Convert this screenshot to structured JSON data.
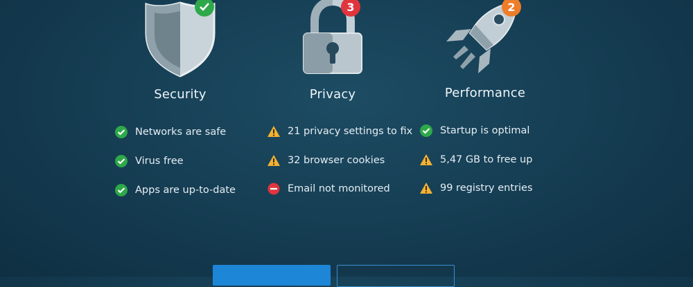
{
  "security": {
    "title": "Security",
    "icon": "shield-icon",
    "badge_icon": "checkmark-icon",
    "items": [
      {
        "status": "ok",
        "label": "Networks are safe"
      },
      {
        "status": "ok",
        "label": "Virus free"
      },
      {
        "status": "ok",
        "label": "Apps are up-to-date"
      }
    ]
  },
  "privacy": {
    "title": "Privacy",
    "icon": "padlock-icon",
    "badge": "3",
    "items": [
      {
        "status": "warning",
        "label": "21 privacy settings to fix"
      },
      {
        "status": "warning",
        "label": "32 browser cookies"
      },
      {
        "status": "error",
        "label": "Email not monitored"
      }
    ]
  },
  "performance": {
    "title": "Performance",
    "icon": "rocket-icon",
    "badge": "2",
    "items": [
      {
        "status": "ok",
        "label": "Startup is optimal"
      },
      {
        "status": "warning",
        "label": "5,47 GB to free up"
      },
      {
        "status": "warning",
        "label": "99 registry entries"
      }
    ]
  },
  "colors": {
    "ok": "#2ea84a",
    "warning": "#f2b233",
    "error": "#e0353d",
    "primary_button": "#1e86d6",
    "background": "#163f55"
  }
}
